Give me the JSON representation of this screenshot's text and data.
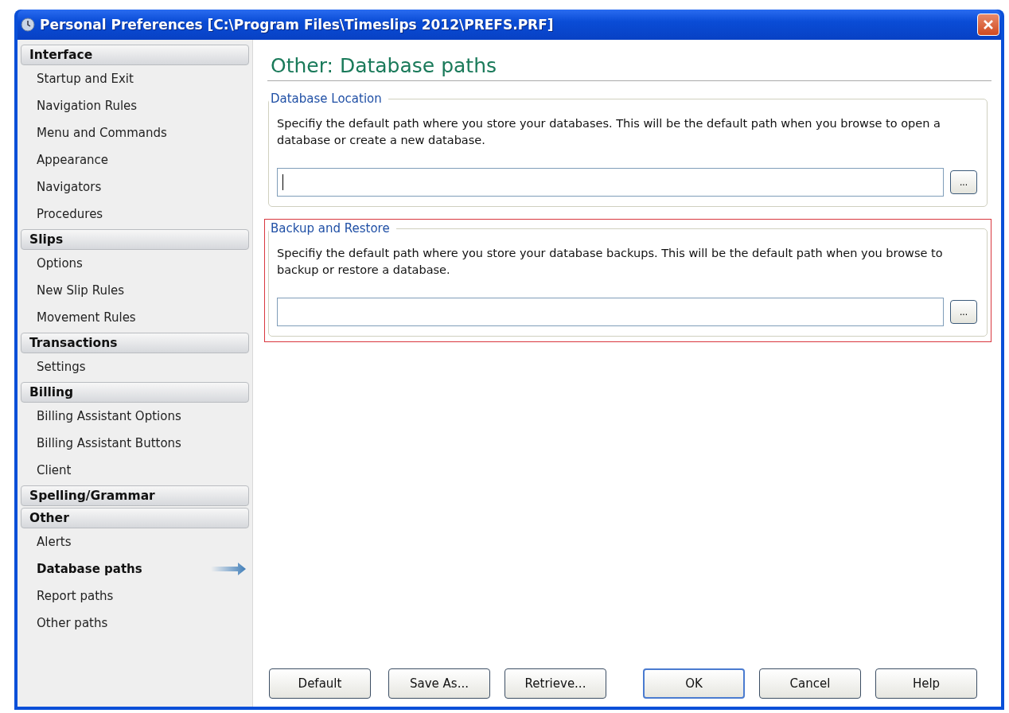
{
  "window": {
    "title": "Personal Preferences [C:\\Program Files\\Timeslips 2012\\PREFS.PRF]"
  },
  "sidebar": {
    "groups": [
      {
        "heading": "Interface",
        "items": [
          {
            "label": "Startup and Exit",
            "selected": false
          },
          {
            "label": "Navigation Rules",
            "selected": false
          },
          {
            "label": "Menu and Commands",
            "selected": false
          },
          {
            "label": "Appearance",
            "selected": false
          },
          {
            "label": "Navigators",
            "selected": false
          },
          {
            "label": "Procedures",
            "selected": false
          }
        ]
      },
      {
        "heading": "Slips",
        "items": [
          {
            "label": "Options",
            "selected": false
          },
          {
            "label": "New Slip Rules",
            "selected": false
          },
          {
            "label": "Movement Rules",
            "selected": false
          }
        ]
      },
      {
        "heading": "Transactions",
        "items": [
          {
            "label": "Settings",
            "selected": false
          }
        ]
      },
      {
        "heading": "Billing",
        "items": [
          {
            "label": "Billing Assistant Options",
            "selected": false
          },
          {
            "label": "Billing Assistant Buttons",
            "selected": false
          },
          {
            "label": "Client",
            "selected": false
          }
        ]
      },
      {
        "heading": "Spelling/Grammar"
      },
      {
        "heading": "Other",
        "items": [
          {
            "label": "Alerts",
            "selected": false
          },
          {
            "label": "Database paths",
            "selected": true
          },
          {
            "label": "Report paths",
            "selected": false
          },
          {
            "label": "Other paths",
            "selected": false
          }
        ]
      }
    ]
  },
  "page_title": "Other: Database paths",
  "sections": [
    {
      "legend": "Database Location",
      "description": "Specifiy the default path where you store your databases. This will be the default path when you browse to open a database or create a new database.",
      "field_focused": true,
      "browse_button": "...",
      "highlighted": false
    },
    {
      "legend": "Backup and Restore",
      "description": "Specifiy the default path where you store your database backups. This will be the default path when you browse to backup or restore a database.",
      "field_focused": false,
      "browse_button": "...",
      "highlighted": true
    }
  ],
  "buttons": [
    {
      "label": "Default",
      "default": false
    },
    {
      "label": "Save As...",
      "default": false
    },
    {
      "label": "Retrieve...",
      "default": false
    },
    {
      "label": "OK",
      "default": true
    },
    {
      "label": "Cancel",
      "default": false
    },
    {
      "label": "Help",
      "default": false
    }
  ]
}
